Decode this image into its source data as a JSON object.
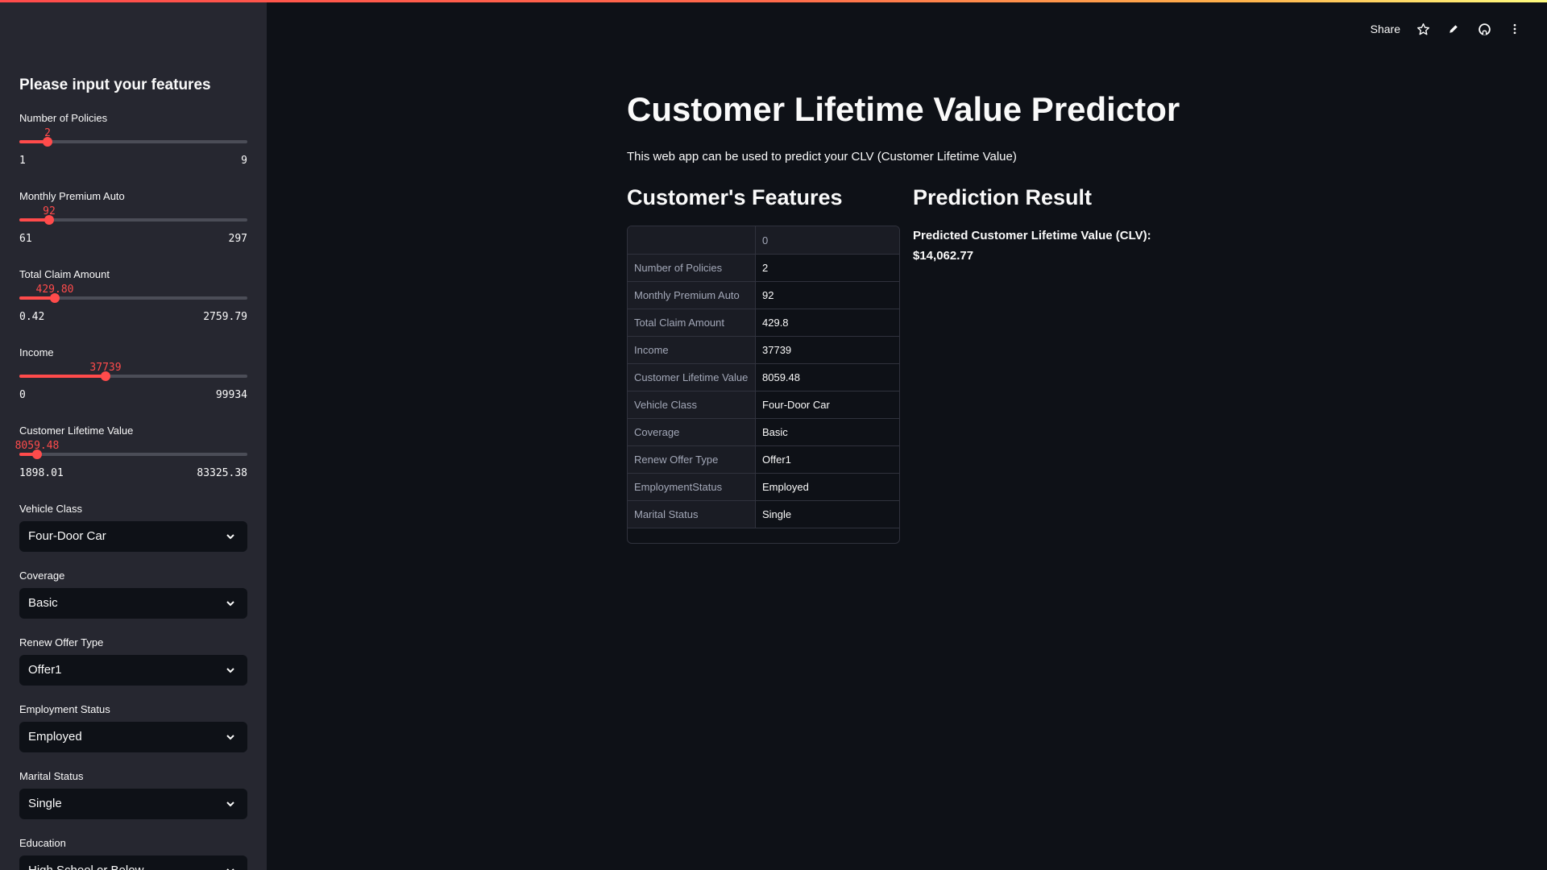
{
  "header": {
    "share_label": "Share",
    "icons": [
      "star-icon",
      "pencil-icon",
      "github-icon",
      "more-vertical-icon"
    ]
  },
  "sidebar": {
    "title": "Please input your features",
    "sliders": [
      {
        "label": "Number of Policies",
        "value": "2",
        "min": "1",
        "max": "9",
        "fraction": 0.125
      },
      {
        "label": "Monthly Premium Auto",
        "value": "92",
        "min": "61",
        "max": "297",
        "fraction": 0.131
      },
      {
        "label": "Total Claim Amount",
        "value": "429.80",
        "min": "0.42",
        "max": "2759.79",
        "fraction": 0.156
      },
      {
        "label": "Income",
        "value": "37739",
        "min": "0",
        "max": "99934",
        "fraction": 0.378
      },
      {
        "label": "Customer Lifetime Value",
        "value": "8059.48",
        "min": "1898.01",
        "max": "83325.38",
        "fraction": 0.076
      }
    ],
    "selects": [
      {
        "label": "Vehicle Class",
        "value": "Four-Door Car"
      },
      {
        "label": "Coverage",
        "value": "Basic"
      },
      {
        "label": "Renew Offer Type",
        "value": "Offer1"
      },
      {
        "label": "Employment Status",
        "value": "Employed"
      },
      {
        "label": "Marital Status",
        "value": "Single"
      },
      {
        "label": "Education",
        "value": "High School or Below"
      }
    ]
  },
  "main": {
    "title": "Customer Lifetime Value Predictor",
    "description": "This web app can be used to predict your CLV (Customer Lifetime Value)",
    "features_heading": "Customer's Features",
    "result_heading": "Prediction Result",
    "table": {
      "column_header": "0",
      "rows": [
        {
          "name": "Number of Policies",
          "value": "2"
        },
        {
          "name": "Monthly Premium Auto",
          "value": "92"
        },
        {
          "name": "Total Claim Amount",
          "value": "429.8"
        },
        {
          "name": "Income",
          "value": "37739"
        },
        {
          "name": "Customer Lifetime Value",
          "value": "8059.48"
        },
        {
          "name": "Vehicle Class",
          "value": "Four-Door Car"
        },
        {
          "name": "Coverage",
          "value": "Basic"
        },
        {
          "name": "Renew Offer Type",
          "value": "Offer1"
        },
        {
          "name": "EmploymentStatus",
          "value": "Employed"
        },
        {
          "name": "Marital Status",
          "value": "Single"
        }
      ]
    },
    "prediction_label": "Predicted Customer Lifetime Value (CLV):",
    "prediction_value": "$14,062.77"
  },
  "colors": {
    "accent": "#ff4b4b",
    "background": "#0e1117",
    "sidebar": "#262730"
  }
}
